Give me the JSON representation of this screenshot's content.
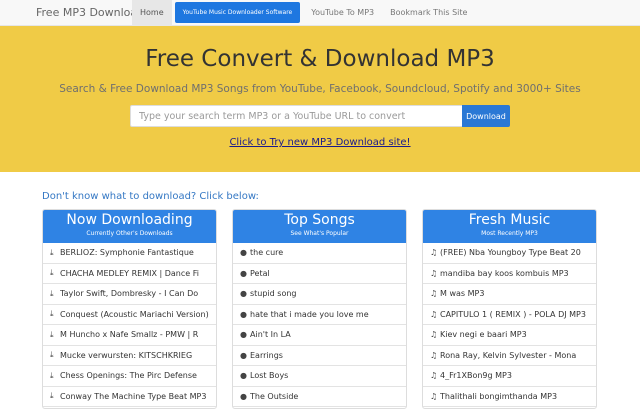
{
  "nav": {
    "brand": "Free MP3 Download",
    "items": [
      "Home",
      "YouTube Music Downloader Software",
      "YouTube To MP3",
      "Bookmark This Site"
    ]
  },
  "hero": {
    "title": "Free Convert & Download MP3",
    "subtitle": "Search & Free Download MP3 Songs from YouTube, Facebook, Soundcloud, Spotify and 3000+ Sites",
    "search_placeholder": "Type your search term MP3 or a YouTube URL to convert",
    "search_button": "Download",
    "try_link": "Click to Try new MP3 Download site!"
  },
  "hint": "Don't know what to download? Click below:",
  "panels": [
    {
      "title": "Now Downloading",
      "subtitle": "Currently Other's Downloads",
      "icon": "download-icon",
      "items": [
        "BERLIOZ: Symphonie Fantastique",
        "CHACHA MEDLEY REMIX | Dance Fi",
        "Taylor Swift, Dombresky - I Can Do",
        "Conquest (Acoustic Mariachi Version)",
        "M Huncho x Nafe Smallz - PMW | R",
        "Mucke verwursten: KITSCHKRIEG",
        "Chess Openings: The Pirc Defense",
        "Conway The Machine Type Beat MP3"
      ]
    },
    {
      "title": "Top Songs",
      "subtitle": "See What's Popular",
      "icon": "globe-icon",
      "items": [
        "the cure",
        "Petal",
        "stupid song",
        "hate that i made you love me",
        "Ain't In LA",
        "Earrings",
        "Lost Boys",
        "The Outside"
      ]
    },
    {
      "title": "Fresh Music",
      "subtitle": "Most Recently MP3",
      "icon": "music-note-icon",
      "items": [
        "(FREE) Nba Youngboy Type Beat 20",
        "mandiba bay koos kombuis MP3",
        "M was MP3",
        "CAPITULO 1 ( REMIX ) - POLA DJ MP3",
        "Kiev negi e baari MP3",
        "Rona Ray, Kelvin Sylvester - Mona",
        "4_Fr1XBon9g MP3",
        "Thalithali bongimthanda MP3"
      ]
    }
  ]
}
